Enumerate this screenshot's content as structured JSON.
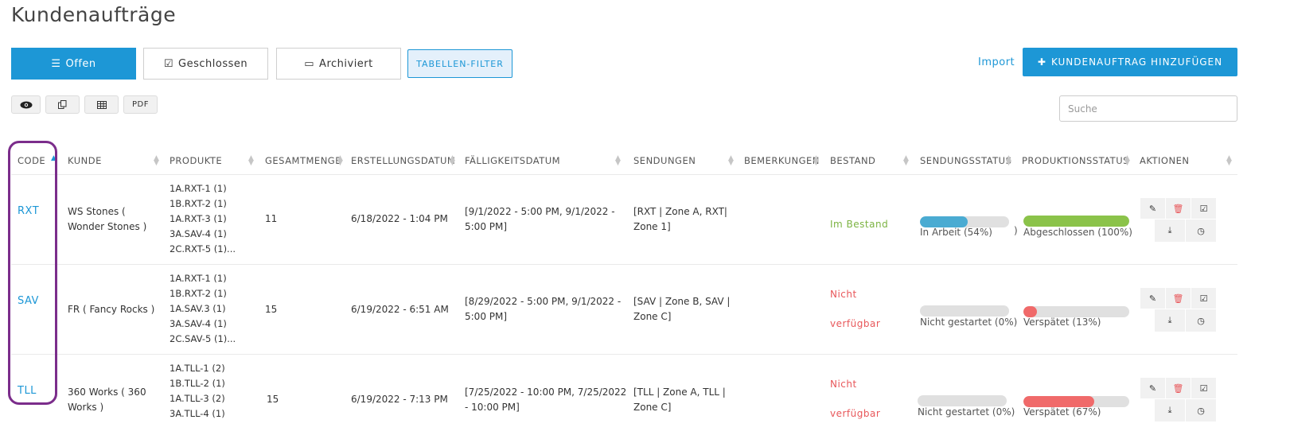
{
  "page": {
    "title": "Kundenaufträge"
  },
  "tabs": [
    {
      "label": "Offen",
      "icon": "list-icon",
      "active": true
    },
    {
      "label": "Geschlossen",
      "icon": "check-square-icon",
      "active": false
    },
    {
      "label": "Archiviert",
      "icon": "inbox-icon",
      "active": false
    }
  ],
  "filter_label": "TABELLEN-FILTER",
  "import_label": "Import",
  "add_label": "KUNDENAUFTRAG HINZUFÜGEN",
  "toolbar": {
    "view_icon": "eye-icon",
    "copy_icon": "copy-icon",
    "table_icon": "table-icon",
    "pdf_label": "PDF"
  },
  "search": {
    "placeholder": "Suche",
    "value": ""
  },
  "columns": [
    "CODE",
    "KUNDE",
    "PRODUKTE",
    "GESAMTMENGE",
    "ERSTELLUNGSDATUM",
    "FÄLLIGKEITSDATUM",
    "SENDUNGEN",
    "BEMERKUNGEN",
    "BESTAND",
    "SENDUNGSSTATUS",
    "PRODUKTIONSSTATUS",
    "AKTIONEN"
  ],
  "rows": [
    {
      "code": "RXT",
      "customer": [
        "WS Stones (",
        "Wonder Stones )"
      ],
      "products": [
        "1A.RXT-1 (1)",
        "1B.RXT-2 (1)",
        "1A.RXT-3 (1)",
        "3A.SAV-4 (1)",
        "2C.RXT-5 (1)..."
      ],
      "total": "11",
      "created": "6/18/2022 - 1:04 PM",
      "due": [
        "[9/1/2022 - 5:00 PM, 9/1/2022 -",
        "5:00 PM]"
      ],
      "shipments": [
        "[RXT | Zone A, RXT|",
        "Zone 1]"
      ],
      "remarks": "",
      "stock": "Im Bestand",
      "stock_available": true,
      "ship_status": {
        "label": "In Arbeit (54%)",
        "percent": 54,
        "color": "#4aabd2",
        "suffix": ")"
      },
      "prod_status": {
        "label": "Abgeschlossen (100%)",
        "percent": 100,
        "color": "#8bc34a"
      }
    },
    {
      "code": "SAV",
      "customer": [
        "FR ( Fancy Rocks )"
      ],
      "products": [
        "1A.RXT-1 (1)",
        "1B.RXT-2 (1)",
        "1A.SAV.3 (1)",
        "3A.SAV-4 (1)",
        "2C.SAV-5 (1)..."
      ],
      "total": "15",
      "created": "6/19/2022 - 6:51 AM",
      "due": [
        "[8/29/2022 - 5:00 PM, 9/1/2022 -",
        "5:00 PM]"
      ],
      "shipments": [
        "[SAV | Zone B, SAV |",
        "Zone C]"
      ],
      "remarks": "",
      "stock": [
        "Nicht",
        "verfügbar"
      ],
      "stock_available": false,
      "ship_status": {
        "label": "Nicht gestartet (0%)",
        "percent": 0,
        "color": "#4aabd2"
      },
      "prod_status": {
        "label": "Verspätet (13%)",
        "percent": 13,
        "color": "#f06a6a"
      }
    },
    {
      "code": "TLL",
      "customer": [
        "360 Works ( 360",
        "Works )"
      ],
      "products": [
        "1A.TLL-1 (2)",
        "1B.TLL-2 (1)",
        "1A.TLL-3 (2)",
        "3A.TLL-4 (1)"
      ],
      "total": "15",
      "created": "6/19/2022 - 7:13 PM",
      "due": [
        "[7/25/2022 - 10:00 PM, 7/25/2022",
        "- 10:00 PM]"
      ],
      "shipments": [
        "[TLL | Zone A, TLL |",
        "Zone C]"
      ],
      "remarks": "",
      "stock": [
        "Nicht",
        "verfügbar"
      ],
      "stock_available": false,
      "ship_status": {
        "label": "Nicht gestartet (0%)",
        "percent": 0,
        "color": "#4aabd2"
      },
      "prod_status": {
        "label": "Verspätet (67%)",
        "percent": 67,
        "color": "#f06a6a"
      }
    }
  ],
  "actions": [
    "edit-icon",
    "trash-icon",
    "check-square-icon",
    "download-icon",
    "clock-icon"
  ]
}
